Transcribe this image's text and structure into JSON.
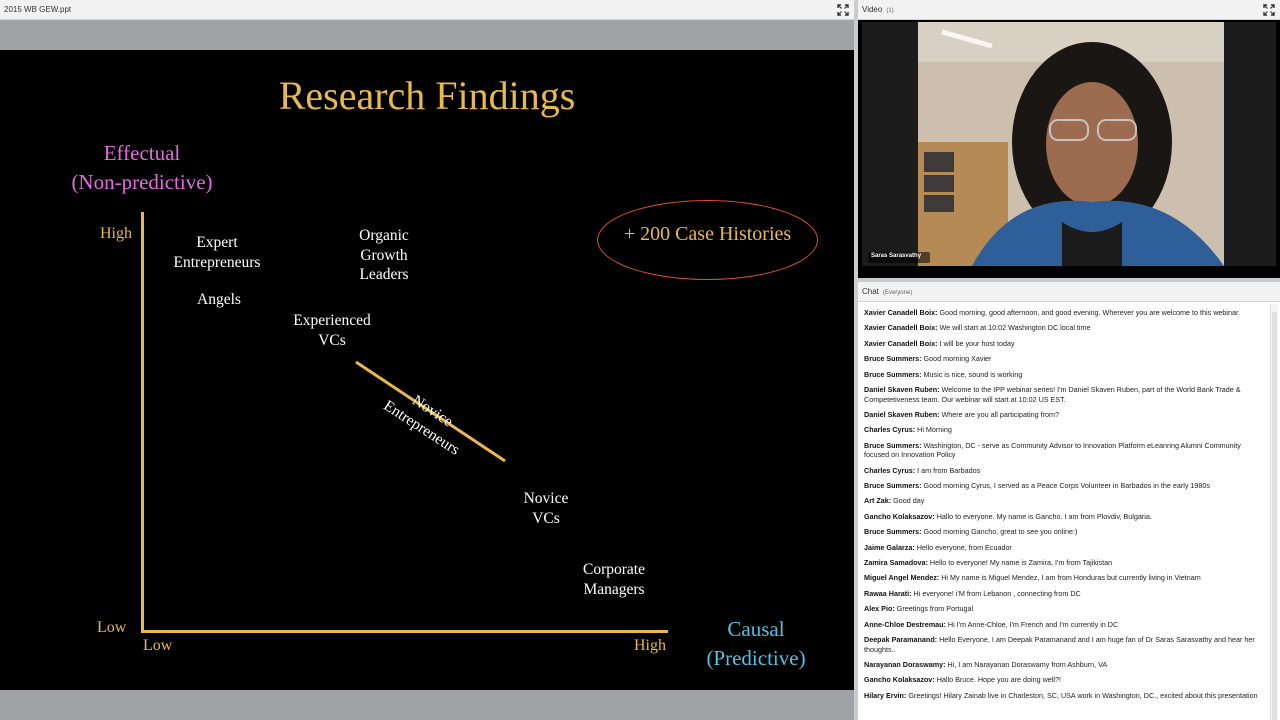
{
  "share_pod": {
    "title": "2015 WB GEW.ppt"
  },
  "slide": {
    "title": "Research Findings",
    "y_axis_title_line1": "Effectual",
    "y_axis_title_line2": "(Non-predictive)",
    "y_high": "High",
    "y_low": "Low",
    "x_low": "Low",
    "x_high": "High",
    "x_axis_title_line1": "Causal",
    "x_axis_title_line2": "(Predictive)",
    "case_histories": "+ 200 Case Histories",
    "labels": {
      "expert_1": "Expert",
      "expert_2": "Entrepreneurs",
      "angels": "Angels",
      "organic_1": "Organic",
      "organic_2": "Growth",
      "organic_3": "Leaders",
      "experienced_1": "Experienced",
      "experienced_2": "VCs",
      "novice_ent_1": "Novice",
      "novice_ent_2": "Entrepreneurs",
      "novice_vc_1": "Novice",
      "novice_vc_2": "VCs",
      "corporate_1": "Corporate",
      "corporate_2": "Managers"
    },
    "colors": {
      "title": "#e9b94a",
      "effectual": "#e56ce0",
      "causal": "#4fc3e6",
      "axis": "#e9b94a",
      "oval": "#e14f2f"
    }
  },
  "video_pod": {
    "title": "Video",
    "count": "(1)",
    "speaker_name": "Saras Sarasvathy"
  },
  "chat_pod": {
    "title": "Chat",
    "audience": "(Everyone)",
    "messages": [
      {
        "sender": "Xavier Canadell Boix:",
        "text": "Good morning, good afternoon, and good evening. Wherever you are welcome to this webinar."
      },
      {
        "sender": "Xavier Canadell Boix:",
        "text": "We will start at 10:02 Washington DC local time"
      },
      {
        "sender": "Xavier Canadell Boix:",
        "text": "I will be your host today"
      },
      {
        "sender": "Bruce Summers:",
        "text": "Good morning Xavier"
      },
      {
        "sender": "Bruce Summers:",
        "text": "Music is nice, sound is working"
      },
      {
        "sender": "Daniel Skaven Ruben:",
        "text": "Welcome to the IPP webinar series! I'm Daniel Skaven Ruben, part of the World Bank Trade & Competetiveness team. Our webinar will start at 10:02 US EST."
      },
      {
        "sender": "Daniel Skaven Ruben:",
        "text": "Where are you all participating from?"
      },
      {
        "sender": "Charles Cyrus:",
        "text": "Hi Morning"
      },
      {
        "sender": "Bruce Summers:",
        "text": "Washington, DC - serve as Community Advisor to Innovation Platform eLeanring Alumni Community focused on Innovation Policy"
      },
      {
        "sender": "Charles Cyrus:",
        "text": "I am from Barbados"
      },
      {
        "sender": "Bruce Summers:",
        "text": "Good morning Cyrus, I served as a Peace Corps Volunteer in Barbados in the early 1980s"
      },
      {
        "sender": "Art Zak:",
        "text": "Good day"
      },
      {
        "sender": "Gancho Kolaksazov:",
        "text": "Hallo to everyone. My name is Gancho. I am from Plovdiv, Bulgaria."
      },
      {
        "sender": "Bruce Summers:",
        "text": "Good morning Gancho, great to see you online:)"
      },
      {
        "sender": "Jaime Galarza:",
        "text": "Hello everyone, from Ecuador"
      },
      {
        "sender": "Zamira Samadova:",
        "text": "Hello to everyone! My name is Zamira, I'm from Tajikistan"
      },
      {
        "sender": "Miguel Angel Mendez:",
        "text": "Hi My name is Miguel Mendez, I am from Honduras but currently living in Vietnam"
      },
      {
        "sender": "Rawaa Harati:",
        "text": "Hi everyone! i'M from Lebanon , connecting from DC"
      },
      {
        "sender": "Alex Pio:",
        "text": "Greetings from Portugal"
      },
      {
        "sender": "Anne-Chloe Destremau:",
        "text": "Hi I'm Anne-Chloe, I'm French and I'm currently in DC"
      },
      {
        "sender": "Deepak Paramanand:",
        "text": "Hello Everyone, I am Deepak Paramanand and I am huge fan of Dr Saras Sarasvathy and hear her thoughts.."
      },
      {
        "sender": "Narayanan Doraswamy:",
        "text": "Hi, I am Narayanan Doraswamy from Ashburn, VA"
      },
      {
        "sender": "Gancho Kolaksazov:",
        "text": "Hallo Bruce. Hope you are doing well?!"
      },
      {
        "sender": "Hilary Ervin:",
        "text": "Greetings! Hilary Zainab live in Charleston, SC, USA work in Washington, DC., excited about this presentation"
      }
    ]
  }
}
